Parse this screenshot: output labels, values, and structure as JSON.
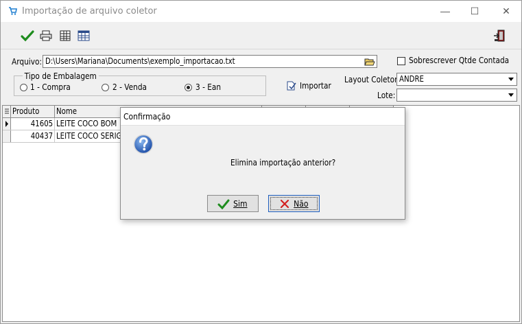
{
  "window": {
    "title": "Importação de arquivo coletor",
    "minimize_glyph": "—",
    "maximize_glyph": "☐",
    "close_glyph": "✕"
  },
  "toolbar": {
    "icons": [
      "check-icon",
      "printer-icon",
      "grid-icon",
      "table-icon",
      "exit-door-icon"
    ]
  },
  "form": {
    "arquivo_label": "Arquivo:",
    "arquivo_value": "D:\\Users\\Mariana\\Documents\\exemplo_importacao.txt",
    "sobrescrever_label": "Sobrescrever Qtde Contada",
    "sobrescrever_checked": false,
    "tipo_embalagem_label": "Tipo de Embalagem",
    "radios": [
      {
        "label": "1 - Compra",
        "checked": false
      },
      {
        "label": "2 - Venda",
        "checked": false
      },
      {
        "label": "3 - Ean",
        "checked": true
      }
    ],
    "importar_label": "Importar",
    "layout_coletor_label": "Layout Coletor:",
    "layout_coletor_value": "ANDRE",
    "lote_label": "Lote:",
    "lote_value": ""
  },
  "grid": {
    "columns": [
      "Produto",
      "Nome",
      "",
      "",
      ""
    ],
    "rows": [
      {
        "produto": "41605",
        "nome": "LEITE COCO BOM"
      },
      {
        "produto": "40437",
        "nome": "LEITE COCO SERIG"
      }
    ]
  },
  "dialog": {
    "title": "Confirmação",
    "message": "Elimina importação anterior?",
    "yes_label": "Sim",
    "no_label": "Não"
  },
  "colors": {
    "accent_blue": "#1f5fbf",
    "check_green": "#1e8c1e",
    "cancel_red": "#d22020"
  }
}
